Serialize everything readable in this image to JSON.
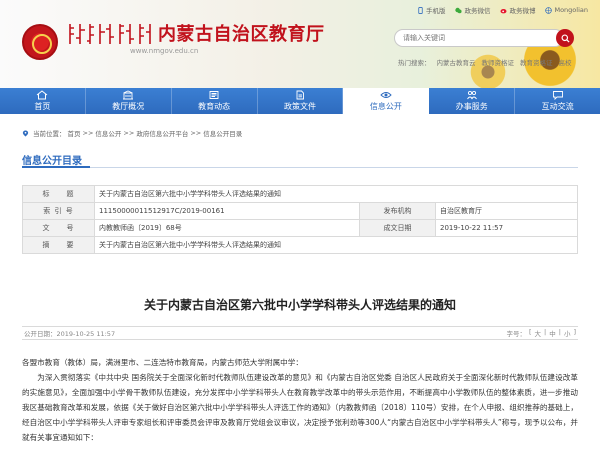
{
  "header": {
    "site_title": "内蒙古自治区教育厅",
    "site_url": "www.nmgov.edu.cn",
    "emblem_icon": "government-emblem-icon",
    "top_links": [
      {
        "label": "手机版",
        "icon": "mobile-icon"
      },
      {
        "label": "政务微信",
        "icon": "wechat-icon"
      },
      {
        "label": "政务微博",
        "icon": "weibo-icon"
      },
      {
        "label": "Mongolian",
        "icon": "globe-icon"
      }
    ],
    "search": {
      "placeholder": "请输入关键词",
      "button_icon": "search-icon"
    },
    "hot_label": "热门搜索：",
    "hot_items": [
      "内蒙古教育云",
      "教师资格证",
      "教育资格证",
      "高校"
    ]
  },
  "nav": [
    {
      "label": "首页",
      "icon": "home-icon",
      "active": false
    },
    {
      "label": "教厅概况",
      "icon": "building-icon",
      "active": false
    },
    {
      "label": "教育动态",
      "icon": "news-icon",
      "active": false
    },
    {
      "label": "政策文件",
      "icon": "document-icon",
      "active": false
    },
    {
      "label": "信息公开",
      "icon": "eye-icon",
      "active": true
    },
    {
      "label": "办事服务",
      "icon": "people-icon",
      "active": false
    },
    {
      "label": "互动交流",
      "icon": "chat-icon",
      "active": false
    }
  ],
  "breadcrumb": {
    "prefix": "当前位置：",
    "items": [
      "首页",
      "信息公开",
      "政府信息公开平台",
      "信息公开目录"
    ],
    "separator": ">>"
  },
  "section_title": "信息公开目录",
  "meta": {
    "title_label": "标　　题",
    "title_value": "关于内蒙古自治区第六批中小学学科带头人评选结果的通知",
    "index_label": "索 引 号",
    "index_value": "11150000011512917C/2019-00161",
    "publisher_label": "发布机构",
    "publisher_value": "自治区教育厅",
    "docno_label": "文　　号",
    "docno_value": "内教教师函〔2019〕68号",
    "date_label": "成文日期",
    "date_value": "2019-10-22 11:57",
    "summary_label": "摘　　要",
    "summary_value": "关于内蒙古自治区第六批中小学学科带头人评选结果的通知"
  },
  "article": {
    "title": "关于内蒙古自治区第六批中小学学科带头人评选结果的通知",
    "publish_time": "公开日期：2019-10-25 11:57",
    "font_label": "字号：",
    "font_sizes": [
      "大",
      "中",
      "小"
    ],
    "greeting": "各盟市教育（教体）局，满洲里市、二连浩特市教育局，内蒙古师范大学附属中学：",
    "paragraph": "为深入贯彻落实《中共中央 国务院关于全面深化新时代教师队伍建设改革的意见》和《内蒙古自治区党委 自治区人民政府关于全面深化新时代教师队伍建设改革的实施意见》，全面加强中小学骨干教师队伍建设，充分发挥中小学学科带头人在教育教学改革中的带头示范作用，不断提高中小学教师队伍的整体素质，进一步推动我区基础教育改革和发展，依据《关于做好自治区第六批中小学学科带头人评选工作的通知》（内教教师函〔2018〕110号）安排，在个人申报、组织推荐的基础上，经自治区中小学学科带头人评审专家组长和评审委员会评审及教育厅党组会议审议，决定授予张利劲等300人“内蒙古自治区中小学学科带头人”称号，现予以公布，并就有关事宜通知如下："
  }
}
